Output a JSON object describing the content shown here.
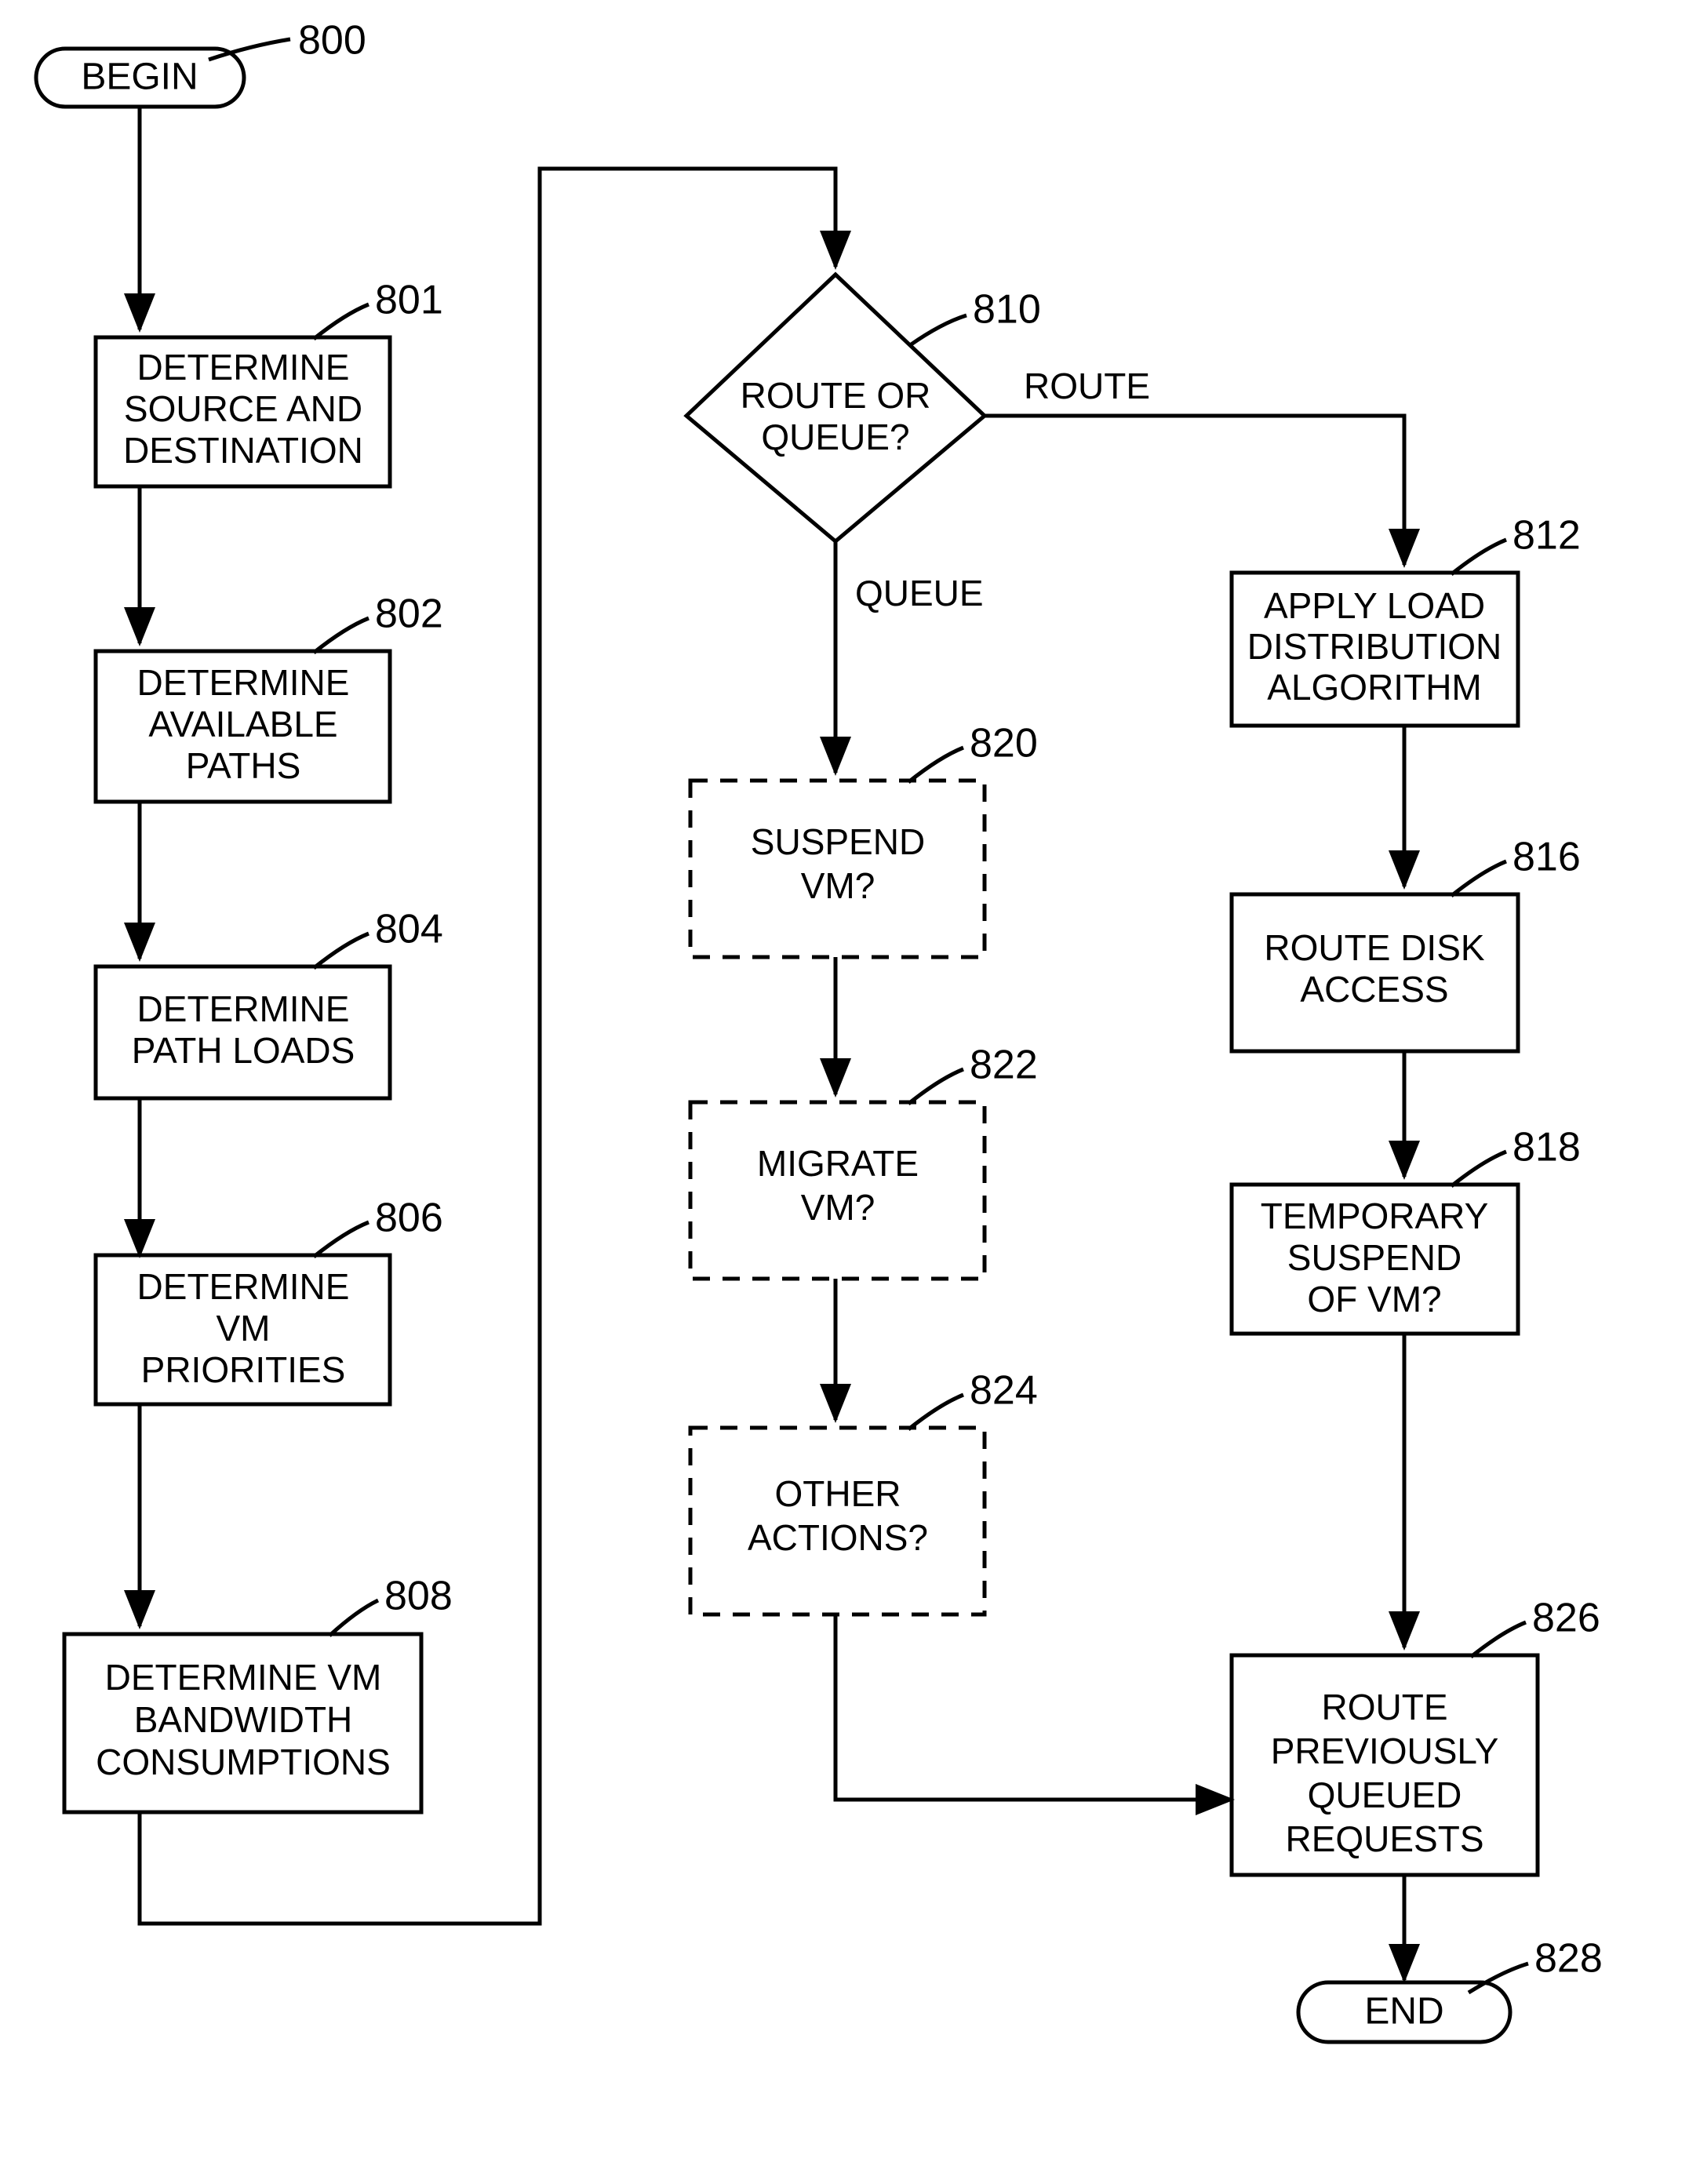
{
  "figure": {
    "type": "flowchart",
    "nodes": [
      {
        "id": "800",
        "ref": "800",
        "label": "BEGIN",
        "shape": "terminator",
        "lines": [
          "BEGIN"
        ]
      },
      {
        "id": "801",
        "ref": "801",
        "shape": "process",
        "lines": [
          "DETERMINE",
          "SOURCE AND",
          "DESTINATION"
        ]
      },
      {
        "id": "802",
        "ref": "802",
        "shape": "process",
        "lines": [
          "DETERMINE",
          "AVAILABLE",
          "PATHS"
        ]
      },
      {
        "id": "804",
        "ref": "804",
        "shape": "process",
        "lines": [
          "DETERMINE",
          "PATH LOADS"
        ]
      },
      {
        "id": "806",
        "ref": "806",
        "shape": "process",
        "lines": [
          "DETERMINE",
          "VM",
          "PRIORITIES"
        ]
      },
      {
        "id": "808",
        "ref": "808",
        "shape": "process",
        "lines": [
          "DETERMINE VM",
          "BANDWIDTH",
          "CONSUMPTIONS"
        ]
      },
      {
        "id": "810",
        "ref": "810",
        "shape": "decision",
        "lines": [
          "ROUTE OR",
          "QUEUE?"
        ]
      },
      {
        "id": "812",
        "ref": "812",
        "shape": "process",
        "lines": [
          "APPLY LOAD",
          "DISTRIBUTION",
          "ALGORITHM"
        ]
      },
      {
        "id": "816",
        "ref": "816",
        "shape": "process",
        "lines": [
          "ROUTE DISK",
          "ACCESS"
        ]
      },
      {
        "id": "818",
        "ref": "818",
        "shape": "process",
        "lines": [
          "TEMPORARY",
          "SUSPEND",
          "OF VM?"
        ]
      },
      {
        "id": "820",
        "ref": "820",
        "shape": "process-optional",
        "lines": [
          "SUSPEND",
          "VM?"
        ]
      },
      {
        "id": "822",
        "ref": "822",
        "shape": "process-optional",
        "lines": [
          "MIGRATE",
          "VM?"
        ]
      },
      {
        "id": "824",
        "ref": "824",
        "shape": "process-optional",
        "lines": [
          "OTHER",
          "ACTIONS?"
        ]
      },
      {
        "id": "826",
        "ref": "826",
        "shape": "process",
        "lines": [
          "ROUTE",
          "PREVIOUSLY",
          "QUEUED",
          "REQUESTS"
        ]
      },
      {
        "id": "828",
        "ref": "828",
        "label": "END",
        "shape": "terminator",
        "lines": [
          "END"
        ]
      }
    ],
    "edge_labels": {
      "route": "ROUTE",
      "queue": "QUEUE"
    },
    "reference_numerals": [
      "800",
      "801",
      "802",
      "804",
      "806",
      "808",
      "810",
      "812",
      "816",
      "818",
      "820",
      "822",
      "824",
      "826",
      "828"
    ],
    "colors": {
      "stroke": "#000000",
      "background": "#ffffff",
      "text": "#000000"
    }
  }
}
